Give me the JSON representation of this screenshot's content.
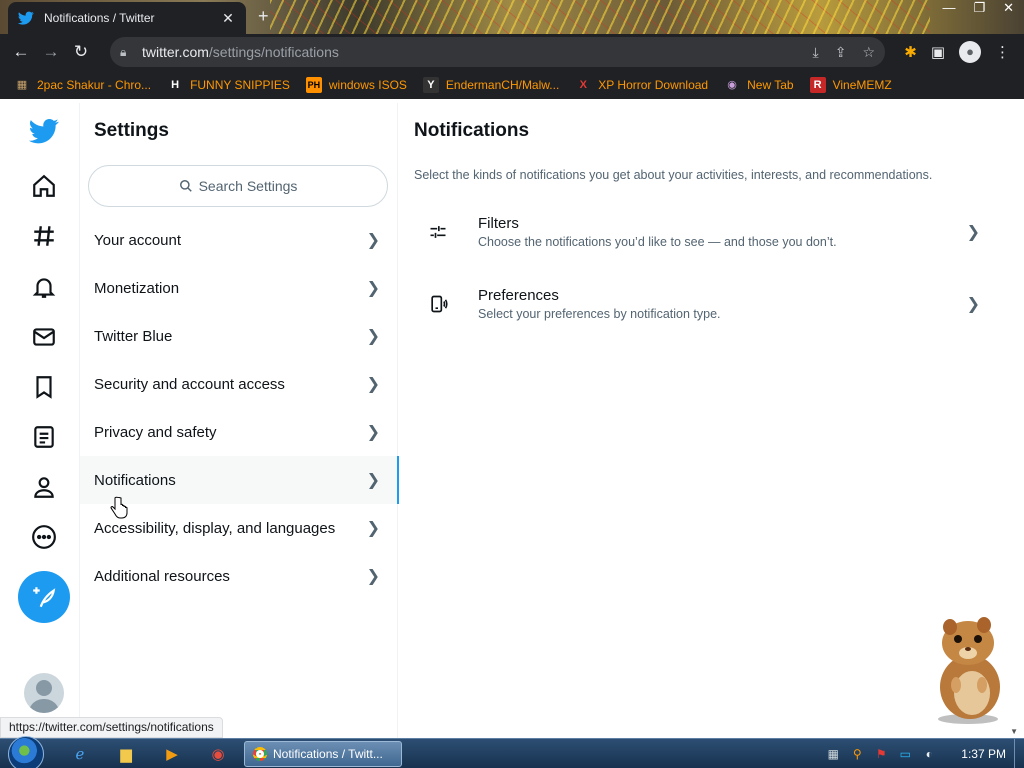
{
  "browser": {
    "tab_title": "Notifications / Twitter",
    "new_tab_glyph": "+",
    "url_host": "twitter.com",
    "url_path": "/settings/notifications",
    "bookmarks": [
      {
        "label": "2pac Shakur - Chro...",
        "icon": "2pac-favicon",
        "glyph": "▦"
      },
      {
        "label": "FUNNY SNIPPIES",
        "icon": "h-favicon",
        "glyph": "H"
      },
      {
        "label": "windows ISOS",
        "icon": "ph-favicon",
        "glyph": "PH"
      },
      {
        "label": "EndermanCH/Malw...",
        "icon": "youtube-favicon",
        "glyph": "Y"
      },
      {
        "label": "XP Horror Download",
        "icon": "x-favicon",
        "glyph": "X"
      },
      {
        "label": "New Tab",
        "icon": "globe-favicon",
        "glyph": "◉"
      },
      {
        "label": "VineMEMZ",
        "icon": "r-favicon",
        "glyph": "R"
      }
    ]
  },
  "settings": {
    "title": "Settings",
    "search_placeholder": "Search Settings",
    "menu": [
      {
        "label": "Your account",
        "selected": false
      },
      {
        "label": "Monetization",
        "selected": false
      },
      {
        "label": "Twitter Blue",
        "selected": false
      },
      {
        "label": "Security and account access",
        "selected": false
      },
      {
        "label": "Privacy and safety",
        "selected": false
      },
      {
        "label": "Notifications",
        "selected": true
      },
      {
        "label": "Accessibility, display, and languages",
        "selected": false
      },
      {
        "label": "Additional resources",
        "selected": false
      }
    ]
  },
  "detail": {
    "title": "Notifications",
    "description": "Select the kinds of notifications you get about your activities, interests, and recommendations.",
    "options": [
      {
        "name": "Filters",
        "sub": "Choose the notifications you’d like to see — and those you don’t.",
        "icon": "sliders-icon"
      },
      {
        "name": "Preferences",
        "sub": "Select your preferences by notification type.",
        "icon": "device-notification-icon"
      }
    ]
  },
  "status_url": "https://twitter.com/settings/notifications",
  "taskbar": {
    "task_label": "Notifications / Twitt...",
    "clock": "1:37 PM"
  },
  "colors": {
    "accent": "#1d9bf0",
    "text_primary": "#0f1419",
    "text_secondary": "#536471"
  }
}
